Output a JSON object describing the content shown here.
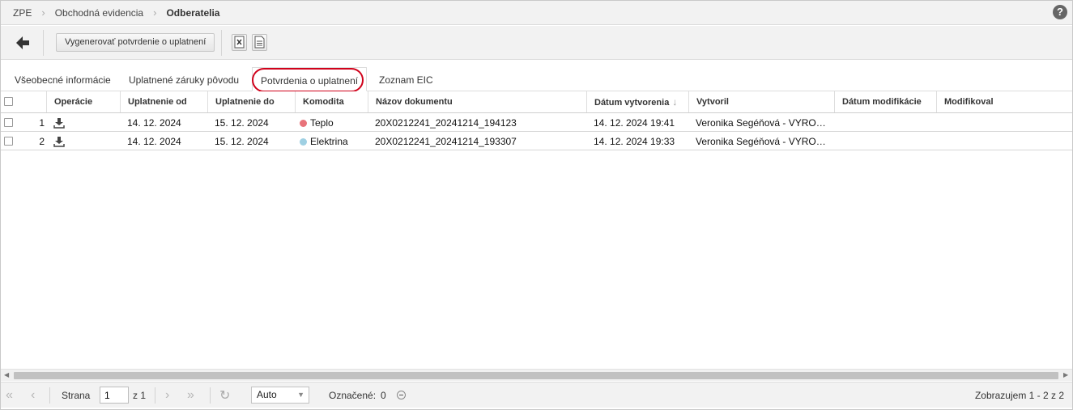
{
  "breadcrumb": {
    "items": [
      "ZPE",
      "Obchodná evidencia",
      "Odberatelia"
    ]
  },
  "help_icon": "?",
  "toolbar": {
    "back_icon": "arrow-left-icon",
    "generate_label": "Vygenerovať potvrdenie o uplatnení",
    "export_excel_icon": "excel-export-icon",
    "export_doc_icon": "document-export-icon"
  },
  "tabs": [
    {
      "label": "Všeobecné informácie"
    },
    {
      "label": "Uplatnené záruky pôvodu"
    },
    {
      "label": "Potvrdenia o uplatnení",
      "active": true
    },
    {
      "label": "Zoznam EIC"
    }
  ],
  "grid": {
    "columns": {
      "operations": "Operácie",
      "applied_from": "Uplatnenie od",
      "applied_to": "Uplatnenie do",
      "commodity": "Komodita",
      "doc_name": "Názov dokumentu",
      "created_date": "Dátum vytvorenia",
      "created_by": "Vytvoril",
      "modified_date": "Dátum modifikácie",
      "modified_by": "Modifikoval"
    },
    "sort_icon": "↓",
    "rows": [
      {
        "num": "1",
        "from": "14. 12. 2024",
        "to": "15. 12. 2024",
        "commodity": "Teplo",
        "commodity_color": "#e8737a",
        "doc": "20X0212241_20241214_194123",
        "created": "14. 12. 2024 19:41",
        "by": "Veronika Segéňová - VYRO…",
        "mod_date": "",
        "mod_by": ""
      },
      {
        "num": "2",
        "from": "14. 12. 2024",
        "to": "15. 12. 2024",
        "commodity": "Elektrina",
        "commodity_color": "#9fd0e3",
        "doc": "20X0212241_20241214_193307",
        "created": "14. 12. 2024 19:33",
        "by": "Veronika Segéňová - VYRO…",
        "mod_date": "",
        "mod_by": ""
      }
    ]
  },
  "pager": {
    "page_label": "Strana",
    "page_value": "1",
    "of_label": "z 1",
    "page_size": "Auto",
    "selected_label": "Označené:",
    "selected_count": "0",
    "summary": "Zobrazujem 1 - 2 z 2"
  }
}
